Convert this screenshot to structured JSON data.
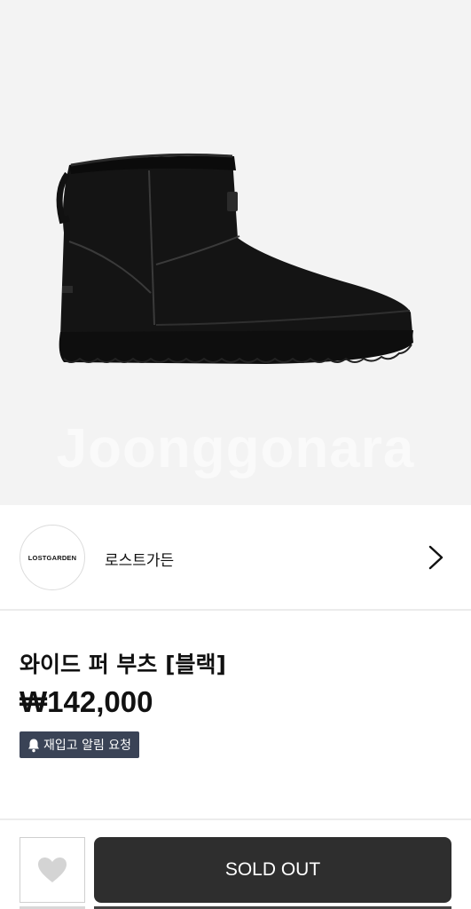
{
  "product": {
    "image_alt": "black suede mini boot",
    "watermark": "Joonggonara",
    "title": "와이드 퍼 부츠 [블랙]",
    "price": "₩142,000"
  },
  "brand": {
    "logo_text": "LOSTGARDEN",
    "name": "로스트가든",
    "chevron_icon": "chevron-right-icon"
  },
  "restock": {
    "label": "재입고 알림 요청",
    "icon": "bell-icon"
  },
  "actions": {
    "wishlist_icon": "heart-icon",
    "primary_label": "SOLD OUT"
  },
  "colors": {
    "hero_bg": "#f3f3f3",
    "badge_bg": "#3a4356",
    "button_bg": "#2e2e2e"
  }
}
